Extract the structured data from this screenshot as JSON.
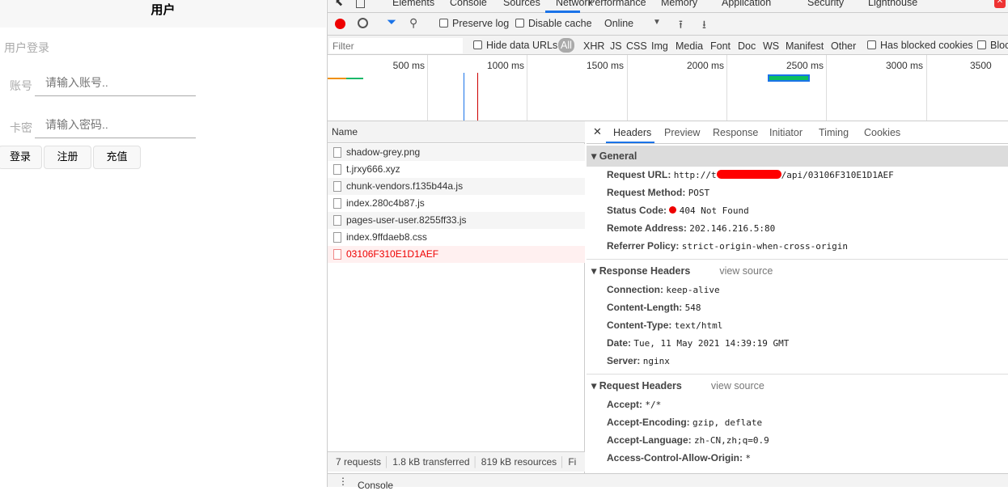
{
  "page": {
    "title": "用户",
    "section": "用户登录",
    "account_label": "账号",
    "account_placeholder": "请输入账号..",
    "password_label": "卡密",
    "password_placeholder": "请输入密码..",
    "buttons": [
      "登录",
      "注册",
      "充值"
    ]
  },
  "devtools": {
    "tabs": [
      "Elements",
      "Console",
      "Sources",
      "Network",
      "Performance",
      "Memory",
      "Application",
      "Security",
      "Lighthouse"
    ],
    "active_tab": "Network",
    "toolbar": {
      "preserve_log": "Preserve log",
      "disable_cache": "Disable cache",
      "throttle": "Online"
    },
    "filter": {
      "placeholder": "Filter",
      "hide_data_urls": "Hide data URLs",
      "types": [
        "All",
        "XHR",
        "JS",
        "CSS",
        "Img",
        "Media",
        "Font",
        "Doc",
        "WS",
        "Manifest",
        "Other"
      ],
      "blocked": "Has blocked cookies",
      "blocked2": "Bloc"
    },
    "timeline_ticks": [
      "500 ms",
      "1000 ms",
      "1500 ms",
      "2000 ms",
      "2500 ms",
      "3000 ms",
      "3500"
    ],
    "name_header": "Name",
    "requests": [
      {
        "name": "shadow-grey.png",
        "error": false
      },
      {
        "name": "t.jrxy666.xyz",
        "error": false
      },
      {
        "name": "chunk-vendors.f135b44a.js",
        "error": false
      },
      {
        "name": "index.280c4b87.js",
        "error": false
      },
      {
        "name": "pages-user-user.8255ff33.js",
        "error": false
      },
      {
        "name": "index.9ffdaeb8.css",
        "error": false
      },
      {
        "name": "03106F310E1D1AEF",
        "error": true
      }
    ],
    "status": {
      "requests": "7 requests",
      "transferred": "1.8 kB transferred",
      "resources": "819 kB resources",
      "finish": "Fi"
    },
    "detail_tabs": [
      "Headers",
      "Preview",
      "Response",
      "Initiator",
      "Timing",
      "Cookies"
    ],
    "general": {
      "title": "General",
      "rows": [
        {
          "k": "Request URL:",
          "v_prefix": "http://t",
          "v_suffix": "/api/03106F310E1D1AEF"
        },
        {
          "k": "Request Method:",
          "v": "POST"
        },
        {
          "k": "Status Code:",
          "v": "404 Not Found"
        },
        {
          "k": "Remote Address:",
          "v": "202.146.216.5:80"
        },
        {
          "k": "Referrer Policy:",
          "v": "strict-origin-when-cross-origin"
        }
      ]
    },
    "response_headers": {
      "title": "Response Headers",
      "view_source": "view source",
      "rows": [
        {
          "k": "Connection:",
          "v": "keep-alive"
        },
        {
          "k": "Content-Length:",
          "v": "548"
        },
        {
          "k": "Content-Type:",
          "v": "text/html"
        },
        {
          "k": "Date:",
          "v": "Tue, 11 May 2021 14:39:19 GMT"
        },
        {
          "k": "Server:",
          "v": "nginx"
        }
      ]
    },
    "request_headers": {
      "title": "Request Headers",
      "view_source": "view source",
      "rows": [
        {
          "k": "Accept:",
          "v": "*/*"
        },
        {
          "k": "Accept-Encoding:",
          "v": "gzip, deflate"
        },
        {
          "k": "Accept-Language:",
          "v": "zh-CN,zh;q=0.9"
        },
        {
          "k": "Access-Control-Allow-Origin:",
          "v": "*"
        }
      ]
    },
    "drawer": "Console"
  }
}
